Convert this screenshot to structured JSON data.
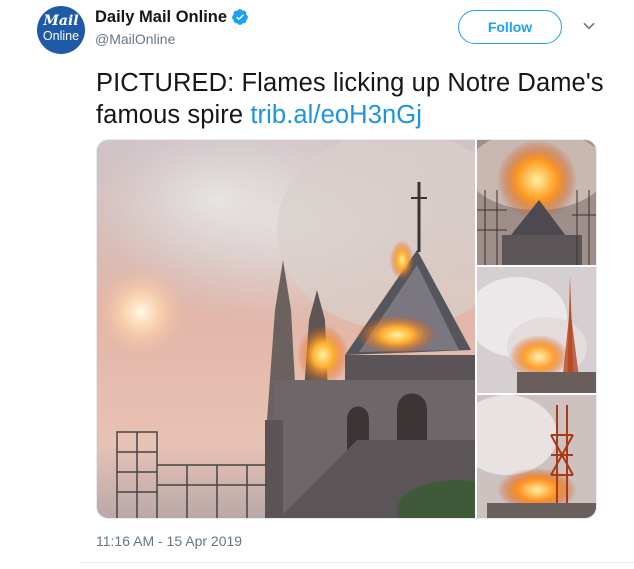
{
  "account": {
    "logo_line1": "Mail",
    "logo_line2": "Online",
    "display_name": "Daily Mail Online",
    "handle": "@MailOnline",
    "verified": true,
    "verified_icon": "verified-badge-icon"
  },
  "actions": {
    "follow_label": "Follow",
    "more_icon": "chevron-down-icon"
  },
  "tweet": {
    "text": "PICTURED: Flames licking up Notre Dame's famous spire ",
    "link_text": "trib.al/eoH3nGj",
    "timestamp": "11:16 AM - 15 Apr 2019"
  },
  "media": {
    "photo_count": 4
  },
  "colors": {
    "accent": "#1da1f2",
    "link": "#1b95e0",
    "secondary_text": "#657786",
    "logo_bg": "#1e5aa8"
  }
}
